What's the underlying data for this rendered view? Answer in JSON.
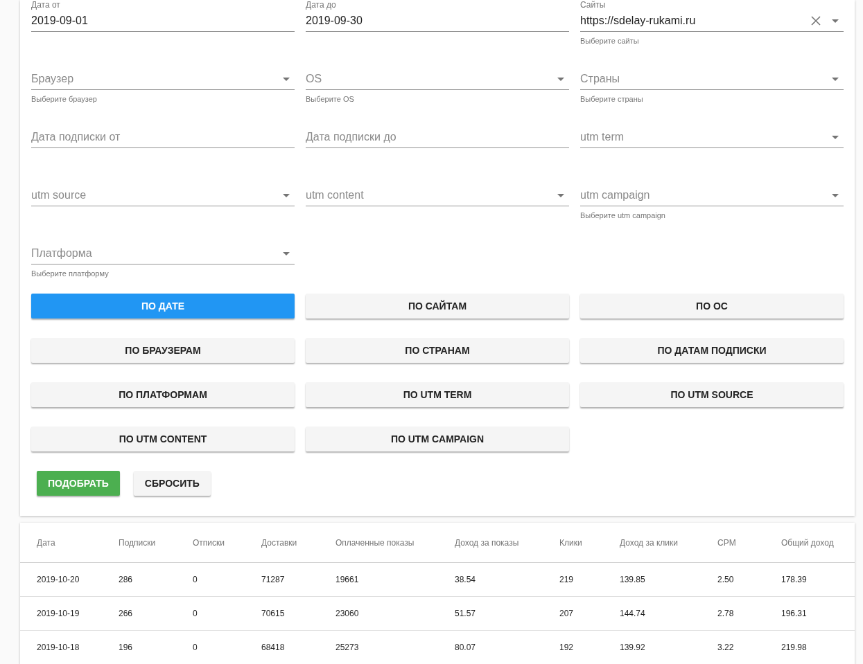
{
  "filters": [
    {
      "kind": "text",
      "label": "Дата от",
      "value": "2019-09-01"
    },
    {
      "kind": "text",
      "label": "Дата до",
      "value": "2019-09-30"
    },
    {
      "kind": "select",
      "label": "Сайты",
      "value": "https://sdelay-rukami.ru",
      "clearable": true,
      "hint": "Выберите сайты"
    },
    {
      "kind": "select",
      "label": "Браузер",
      "hint": "Выберите браузер"
    },
    {
      "kind": "select",
      "label": "OS",
      "hint": "Выберите OS"
    },
    {
      "kind": "select",
      "label": "Страны",
      "hint": "Выберите страны"
    },
    {
      "kind": "text",
      "label": "Дата подписки от"
    },
    {
      "kind": "text",
      "label": "Дата подписки до"
    },
    {
      "kind": "select",
      "label": "utm term"
    },
    {
      "kind": "select",
      "label": "utm source"
    },
    {
      "kind": "select",
      "label": "utm content"
    },
    {
      "kind": "select",
      "label": "utm campaign",
      "hint": "Выберите utm campaign"
    },
    {
      "kind": "select",
      "label": "Платформа",
      "hint": "Выберите платформу"
    }
  ],
  "group_buttons": [
    {
      "label": "ПО ДАТЕ",
      "selected": true
    },
    {
      "label": "ПО САЙТАМ",
      "selected": false
    },
    {
      "label": "ПО ОС",
      "selected": false
    },
    {
      "label": "ПО БРАУЗЕРАМ",
      "selected": false
    },
    {
      "label": "ПО СТРАНАМ",
      "selected": false
    },
    {
      "label": "ПО ДАТАМ ПОДПИСКИ",
      "selected": false
    },
    {
      "label": "ПО ПЛАТФОРМАМ",
      "selected": false
    },
    {
      "label": "ПО UTM TERM",
      "selected": false
    },
    {
      "label": "ПО UTM SOURCE",
      "selected": false
    },
    {
      "label": "ПО UTM CONTENT",
      "selected": false
    },
    {
      "label": "ПО UTM CAMPAIGN",
      "selected": false
    }
  ],
  "actions": [
    {
      "kind": "primary",
      "label": "ПОДОБРАТЬ"
    },
    {
      "kind": "plain",
      "label": "СБРОСИТЬ"
    }
  ],
  "table": {
    "columns": [
      "Дата",
      "Подписки",
      "Отписки",
      "Доставки",
      "Оплаченные показы",
      "Доход за показы",
      "Клики",
      "Доход за клики",
      "CPM",
      "Общий доход"
    ],
    "rows": [
      [
        "2019-10-20",
        "286",
        "0",
        "71287",
        "19661",
        "38.54",
        "219",
        "139.85",
        "2.50",
        "178.39"
      ],
      [
        "2019-10-19",
        "266",
        "0",
        "70615",
        "23060",
        "51.57",
        "207",
        "144.74",
        "2.78",
        "196.31"
      ],
      [
        "2019-10-18",
        "196",
        "0",
        "68418",
        "25273",
        "80.07",
        "192",
        "139.92",
        "3.22",
        "219.98"
      ]
    ]
  }
}
